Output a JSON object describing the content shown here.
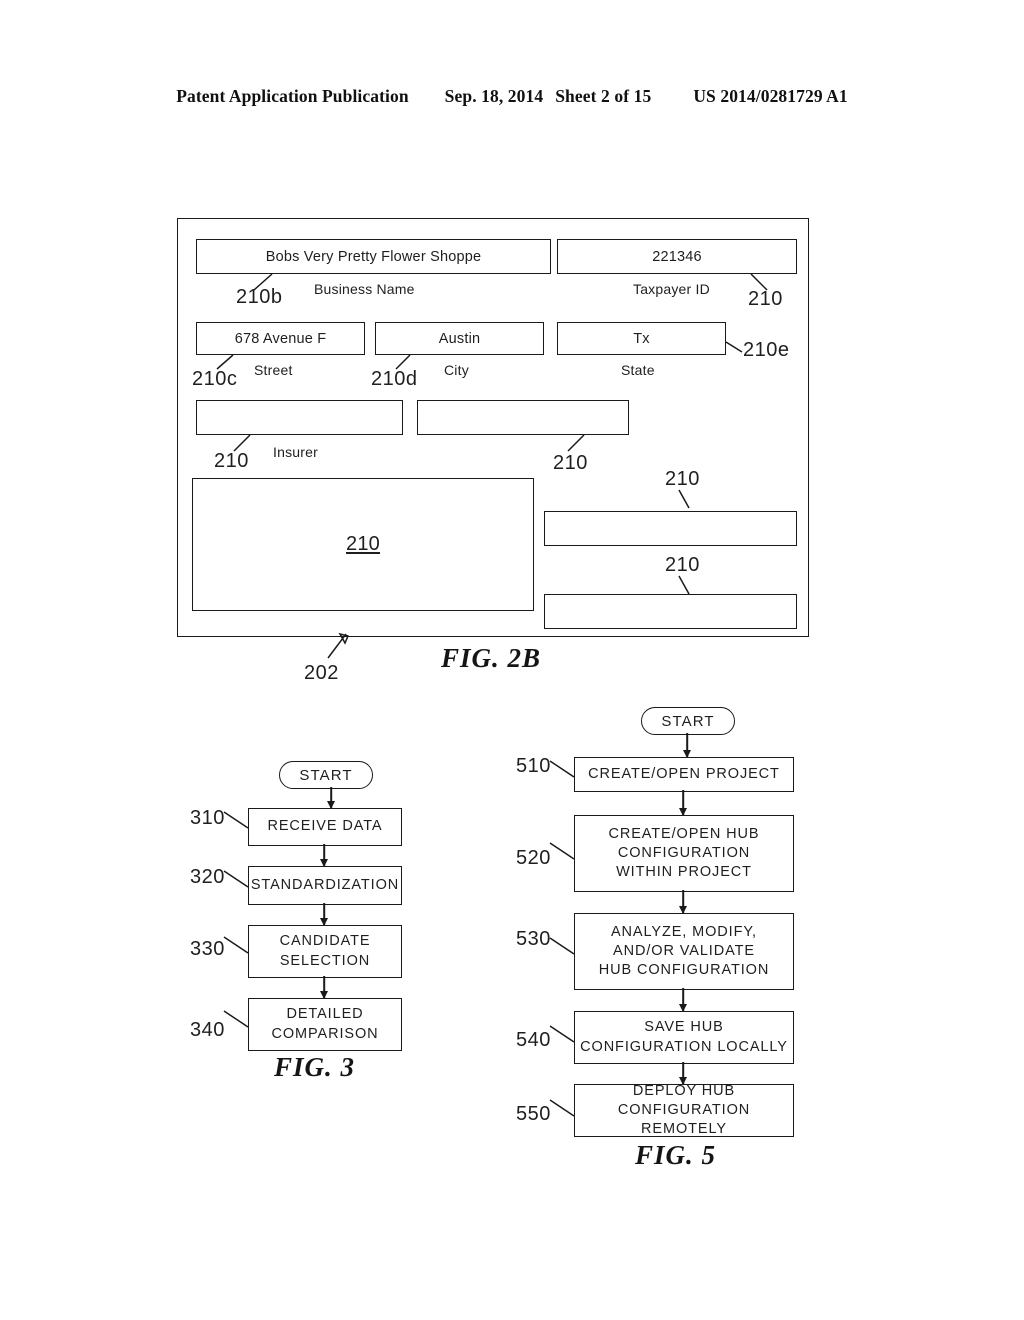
{
  "header": {
    "publication": "Patent Application Publication",
    "date": "Sep. 18, 2014",
    "sheet": "Sheet 2 of 15",
    "number": "US 2014/0281729 A1"
  },
  "fig2b": {
    "caption": "FIG. 2B",
    "panel_ref": "202",
    "fields": [
      {
        "value": "Bobs Very Pretty Flower Shoppe",
        "label": "Business Name",
        "ref": "210b"
      },
      {
        "value": "221346",
        "label": "Taxpayer ID",
        "ref": "210"
      },
      {
        "value": "678 Avenue F",
        "label": "Street",
        "ref": "210c"
      },
      {
        "value": "Austin",
        "label": "City",
        "ref": "210d"
      },
      {
        "value": "Tx",
        "label": "State",
        "ref": "210e"
      },
      {
        "value": "",
        "label": "Insurer",
        "ref": "210"
      },
      {
        "value": "",
        "label": "",
        "ref": "210"
      },
      {
        "value": "",
        "label": "",
        "ref": "210"
      },
      {
        "value": "",
        "label": "",
        "ref": "210"
      }
    ],
    "big_box_ref": "210"
  },
  "fig3": {
    "caption": "FIG. 3",
    "start": "START",
    "steps": [
      {
        "ref": "310",
        "label": "RECEIVE DATA"
      },
      {
        "ref": "320",
        "label": "STANDARDIZATION"
      },
      {
        "ref": "330",
        "label": "CANDIDATE\nSELECTION"
      },
      {
        "ref": "340",
        "label": "DETAILED\nCOMPARISON"
      }
    ]
  },
  "fig5": {
    "caption": "FIG. 5",
    "start": "START",
    "steps": [
      {
        "ref": "510",
        "label": "CREATE/OPEN PROJECT"
      },
      {
        "ref": "520",
        "label": "CREATE/OPEN HUB\nCONFIGURATION\nWITHIN PROJECT"
      },
      {
        "ref": "530",
        "label": "ANALYZE, MODIFY,\nAND/OR VALIDATE\nHUB CONFIGURATION"
      },
      {
        "ref": "540",
        "label": "SAVE HUB\nCONFIGURATION LOCALLY"
      },
      {
        "ref": "550",
        "label": "DEPLOY HUB\nCONFIGURATION REMOTELY"
      }
    ]
  }
}
